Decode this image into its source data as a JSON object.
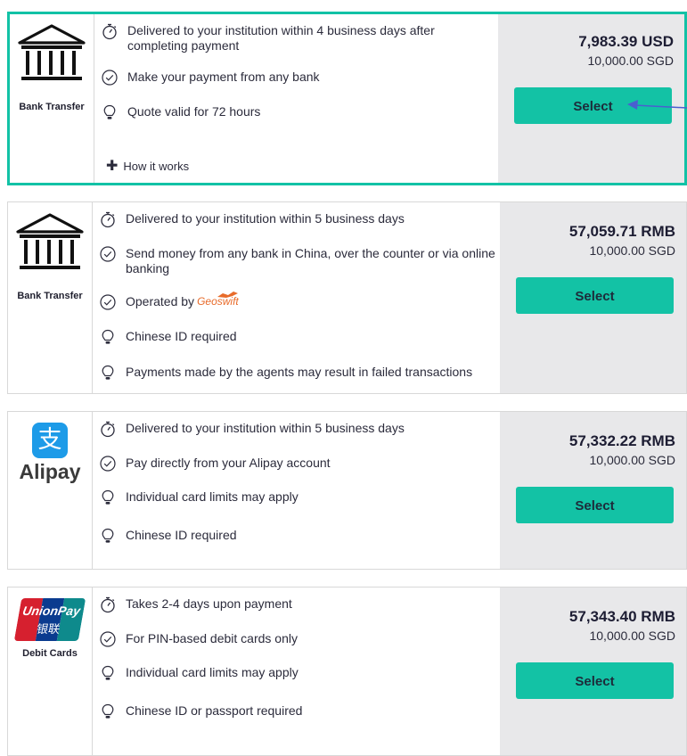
{
  "options": [
    {
      "id": "bank-transfer-usd",
      "logo_label": "Bank Transfer",
      "features": [
        {
          "icon": "stopwatch-icon",
          "text": "Delivered to your institution within 4 business days after completing payment"
        },
        {
          "icon": "check-circle-icon",
          "text": "Make your payment from any bank"
        },
        {
          "icon": "lightbulb-icon",
          "text": "Quote valid for 72 hours"
        }
      ],
      "how_it_works": "How it works",
      "price_main": "7,983.39 USD",
      "price_sub": "10,000.00 SGD",
      "select_label": "Select"
    },
    {
      "id": "bank-transfer-rmb",
      "logo_label": "Bank Transfer",
      "features": [
        {
          "icon": "stopwatch-icon",
          "text": "Delivered to your institution within 5 business days"
        },
        {
          "icon": "check-circle-icon",
          "text": "Send money from any bank in China, over the counter or via online banking"
        },
        {
          "icon": "check-circle-icon",
          "text": "Operated by"
        },
        {
          "icon": "lightbulb-icon",
          "text": "Chinese ID required"
        },
        {
          "icon": "lightbulb-icon",
          "text": "Payments made by the agents may result in failed transactions"
        }
      ],
      "operator_logo_text": "Geoswift",
      "price_main": "57,059.71 RMB",
      "price_sub": "10,000.00 SGD",
      "select_label": "Select"
    },
    {
      "id": "alipay",
      "logo_label": "Alipay",
      "logo_glyph": "支",
      "features": [
        {
          "icon": "stopwatch-icon",
          "text": "Delivered to your institution within 5 business days"
        },
        {
          "icon": "check-circle-icon",
          "text": "Pay directly from your Alipay account"
        },
        {
          "icon": "lightbulb-icon",
          "text": "Individual card limits may apply"
        },
        {
          "icon": "lightbulb-icon",
          "text": "Chinese ID required"
        }
      ],
      "price_main": "57,332.22 RMB",
      "price_sub": "10,000.00 SGD",
      "select_label": "Select"
    },
    {
      "id": "unionpay",
      "logo_label": "Debit Cards",
      "logo_text_en": "UnionPay",
      "logo_text_cn": "银联",
      "features": [
        {
          "icon": "stopwatch-icon",
          "text": "Takes 2-4 days upon payment"
        },
        {
          "icon": "check-circle-icon",
          "text": "For PIN-based debit cards only"
        },
        {
          "icon": "lightbulb-icon",
          "text": "Individual card limits may apply"
        },
        {
          "icon": "lightbulb-icon",
          "text": "Chinese ID or passport required"
        }
      ],
      "price_main": "57,343.40 RMB",
      "price_sub": "10,000.00 SGD",
      "select_label": "Select"
    }
  ],
  "colors": {
    "accent": "#13c2a5",
    "price_panel": "#e8e8ea",
    "border": "#d8d8d8",
    "arrow": "#4a5fd0"
  }
}
